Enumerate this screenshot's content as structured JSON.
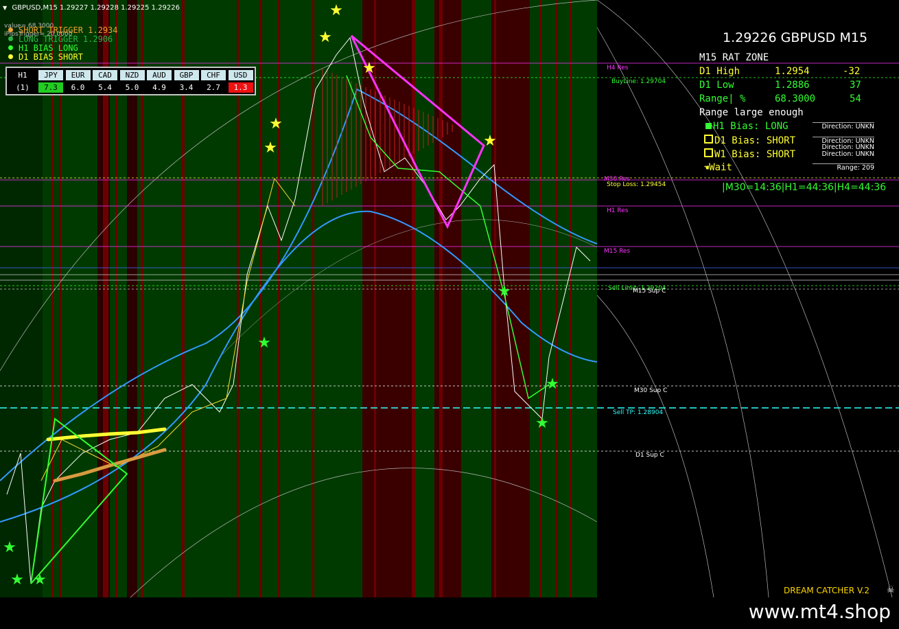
{
  "window": {
    "title": "GBPUSD,M15  1.29227 1.29228 1.29225 1.29226"
  },
  "top_left_small": {
    "value_text": "value= 68.3000",
    "pips_text": "iPipsTrigger= 20.0000"
  },
  "legend": [
    {
      "text": "SHORT TRIGGER 1.2934",
      "color": "#f0a030"
    },
    {
      "text": "LONG TRIGGER  1.2906",
      "color": "#2bb34a"
    },
    {
      "text": "H1 BIAS LONG",
      "color": "#33ff33"
    },
    {
      "text": "D1 BIAS SHORT",
      "color": "#ffff33"
    }
  ],
  "strength_table": {
    "timeframe": "H1",
    "row_label": "(1)",
    "headers": [
      "JPY",
      "EUR",
      "CAD",
      "NZD",
      "AUD",
      "GBP",
      "CHF",
      "USD"
    ],
    "values": [
      "7.3",
      "6.0",
      "5.4",
      "5.0",
      "4.9",
      "3.4",
      "2.7",
      "1.3"
    ],
    "best_color": "#22cc22",
    "worst_color": "#ee1111"
  },
  "info_panel": {
    "price_title": "1.29226 GBPUSD M15",
    "zone_title": "M15 RAT ZONE",
    "rows": [
      {
        "label": "D1 High",
        "value": "1.2954",
        "delta": "-32"
      },
      {
        "label": "D1 Low",
        "value": "1.2886",
        "delta": "37"
      },
      {
        "label": "Range| %",
        "value": "68.3000",
        "delta": "54"
      }
    ],
    "range_note": "Range large enough",
    "bias": [
      {
        "text": "H1 Bias: LONG",
        "marker": "filled"
      },
      {
        "text": "D1 Bias: SHORT",
        "marker": "hollow"
      },
      {
        "text": "W1 Bias: SHORT",
        "marker": "hollow"
      }
    ],
    "wait_text": "Wait",
    "directions": [
      "Direction: UNKN",
      "Direction: UNKN",
      "Direction: UNKN",
      "Direction: UNKN"
    ],
    "range_box": "Range: 209",
    "timers": "|M30=14:36|H1=44:36|H4=44:36",
    "colors": {
      "green": "#33ff33",
      "yellow": "#ffff33"
    }
  },
  "levels": [
    {
      "name": "H4 Res",
      "label": "H4 Res",
      "color": "#ff33ff"
    },
    {
      "name": "BuyLine",
      "label": "BuyLine: 1.29704",
      "color": "#33ff33"
    },
    {
      "name": "M30 Res",
      "label": "M30 Res",
      "color": "#ff33ff"
    },
    {
      "name": "Stop Loss",
      "label": "Stop Loss: 1.29454",
      "color": "#ffff33"
    },
    {
      "name": "H1 Res",
      "label": "H1 Res",
      "color": "#ff33ff"
    },
    {
      "name": "M15 Res",
      "label": "M15 Res",
      "color": "#ff33ff"
    },
    {
      "name": "Sell Limit",
      "label": "Sell Limit: 1.29204",
      "color": "#33ff33"
    },
    {
      "name": "M15 Sup C",
      "label": "M15 Sup C",
      "color": "#ffffff"
    },
    {
      "name": "M30 Sup C",
      "label": "M30 Sup C",
      "color": "#ffffff"
    },
    {
      "name": "Sell TP",
      "label": "Sell TP: 1.28904",
      "color": "#33ffff"
    },
    {
      "name": "D1 Sup C",
      "label": "D1 Sup C",
      "color": "#ffffff"
    }
  ],
  "footer": {
    "indicator_name": "DREAM CATCHER V.2",
    "website": "www.mt4.shop"
  }
}
